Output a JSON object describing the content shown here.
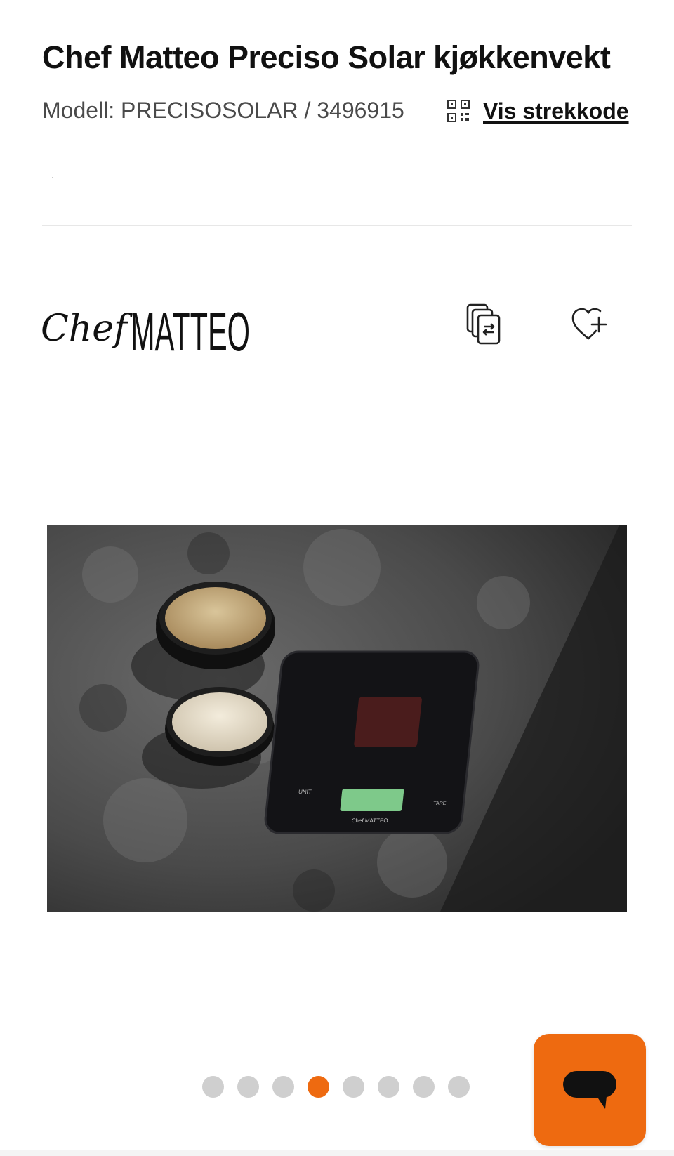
{
  "product": {
    "title": "Chef Matteo Preciso Solar kjøkkenvekt",
    "model_line": "Modell: PRECISOSOLAR / 3496915",
    "barcode_link": "Vis strekkode"
  },
  "brand": {
    "script_word": "Chef",
    "block_word": "MATTEO"
  },
  "icons": {
    "barcode": "qr-code-icon",
    "compare": "compare-icon",
    "wishlist": "heart-plus-icon",
    "chat": "chat-bubble-icon"
  },
  "gallery": {
    "image_description_icon": "product-photo",
    "scale_unit_label": "UNIT",
    "scale_tare_label": "TARE",
    "scale_brand": "Chef MATTEO",
    "dot_count": 8,
    "active_index": 3
  },
  "colors": {
    "accent": "#ee6a10",
    "text": "#111111",
    "muted_text": "#4a4a4a",
    "dot_inactive": "#cfcfcf"
  }
}
